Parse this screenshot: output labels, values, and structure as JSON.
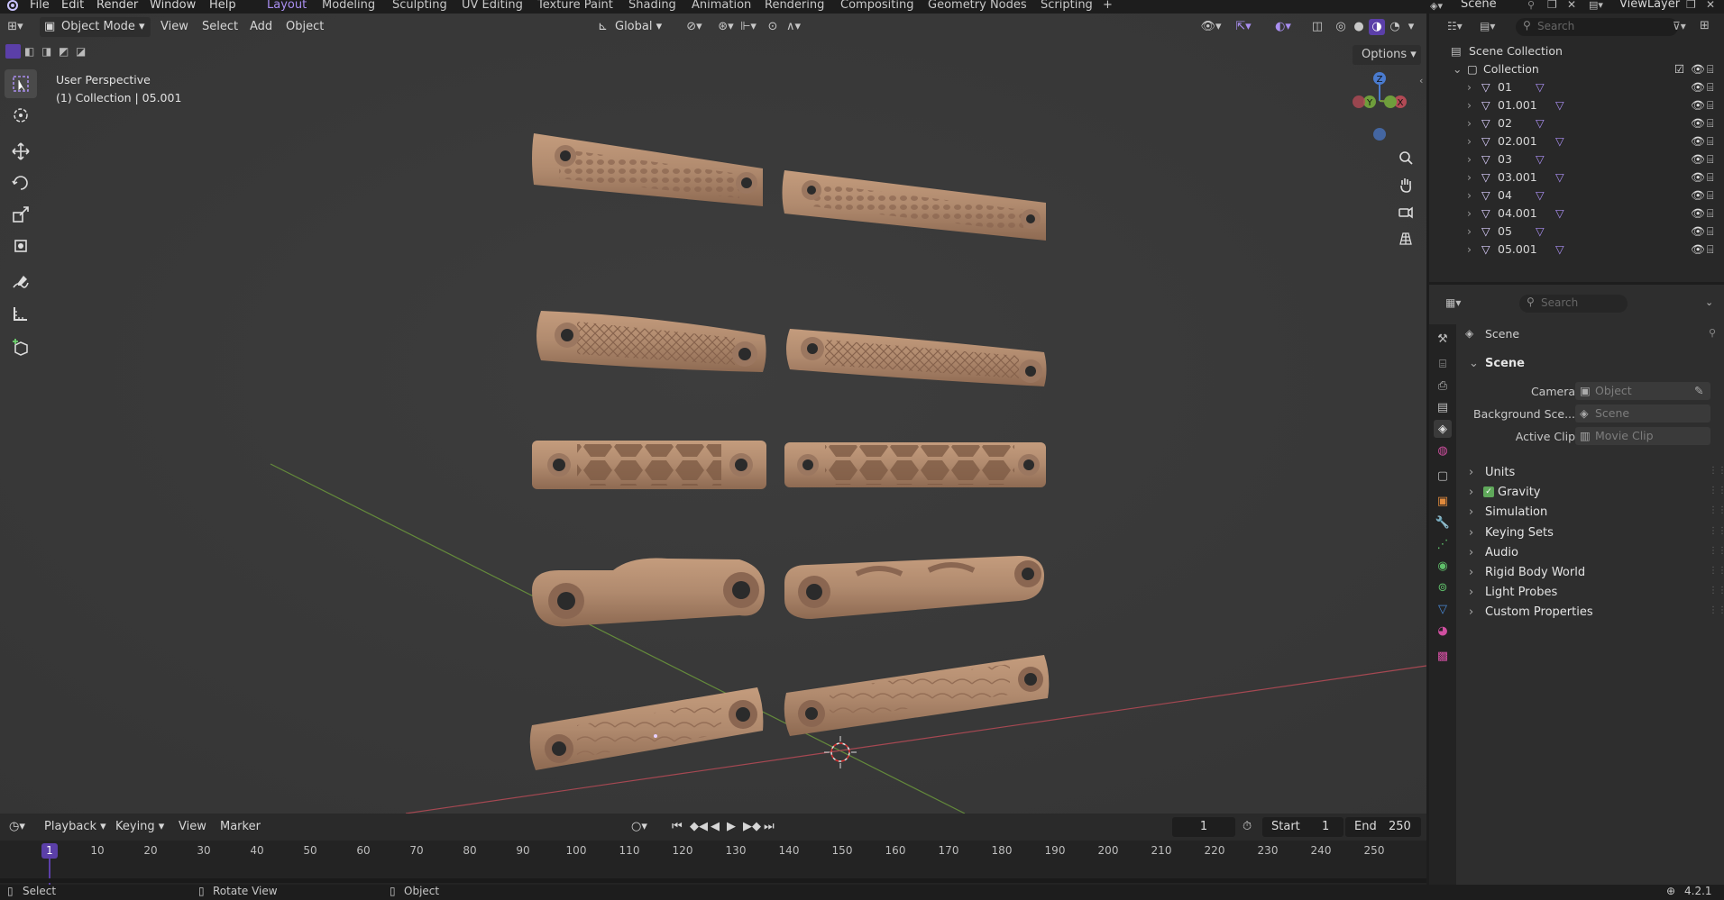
{
  "app": {
    "name": "Blender",
    "version": "4.2.1"
  },
  "top_menu": [
    "File",
    "Edit",
    "Render",
    "Window",
    "Help"
  ],
  "workspaces": [
    "Layout",
    "Modeling",
    "Sculpting",
    "UV Editing",
    "Texture Paint",
    "Shading",
    "Animation",
    "Rendering",
    "Compositing",
    "Geometry Nodes",
    "Scripting"
  ],
  "active_workspace": "Layout",
  "scene_name": "Scene",
  "view_layer": "ViewLayer",
  "viewport": {
    "mode": "Object Mode",
    "menus": [
      "View",
      "Select",
      "Add",
      "Object"
    ],
    "transform_orientation": "Global",
    "options_label": "Options",
    "overlay_title": "User Perspective",
    "overlay_collection": "(1) Collection | 05.001",
    "gizmo_axes": {
      "z": "Z",
      "y": "Y",
      "x": "X"
    }
  },
  "timeline": {
    "menus": [
      "Playback",
      "Keying",
      "View",
      "Marker"
    ],
    "current_frame": "1",
    "start_label": "Start",
    "start": "1",
    "end_label": "End",
    "end": "250",
    "ruler": [
      "1",
      "10",
      "20",
      "30",
      "40",
      "50",
      "60",
      "70",
      "80",
      "90",
      "100",
      "110",
      "120",
      "130",
      "140",
      "150",
      "160",
      "170",
      "180",
      "190",
      "200",
      "210",
      "220",
      "230",
      "240",
      "250"
    ]
  },
  "status_bar": {
    "select": "Select",
    "rotate": "Rotate View",
    "object": "Object",
    "version": "4.2.1"
  },
  "outliner": {
    "search_placeholder": "Search",
    "scene_collection": "Scene Collection",
    "collection": "Collection",
    "objects": [
      "01",
      "01.001",
      "02",
      "02.001",
      "03",
      "03.001",
      "04",
      "04.001",
      "05",
      "05.001"
    ]
  },
  "properties": {
    "search_placeholder": "Search",
    "breadcrumb": "Scene",
    "panel_title": "Scene",
    "camera_label": "Camera",
    "camera_placeholder": "Object",
    "background_label": "Background Sce...",
    "background_placeholder": "Scene",
    "clip_label": "Active Clip",
    "clip_placeholder": "Movie Clip",
    "subpanels": [
      "Units",
      "Gravity",
      "Simulation",
      "Keying Sets",
      "Audio",
      "Rigid Body World",
      "Light Probes",
      "Custom Properties"
    ],
    "gravity_enabled": true
  },
  "colors": {
    "accent": "#a98ef0",
    "active_frame": "#5b3fa8",
    "part_tan": "#b08a6e",
    "x_axis": "#b24a55",
    "y_axis": "#6f9e3c",
    "z_axis": "#4a7bcf"
  }
}
